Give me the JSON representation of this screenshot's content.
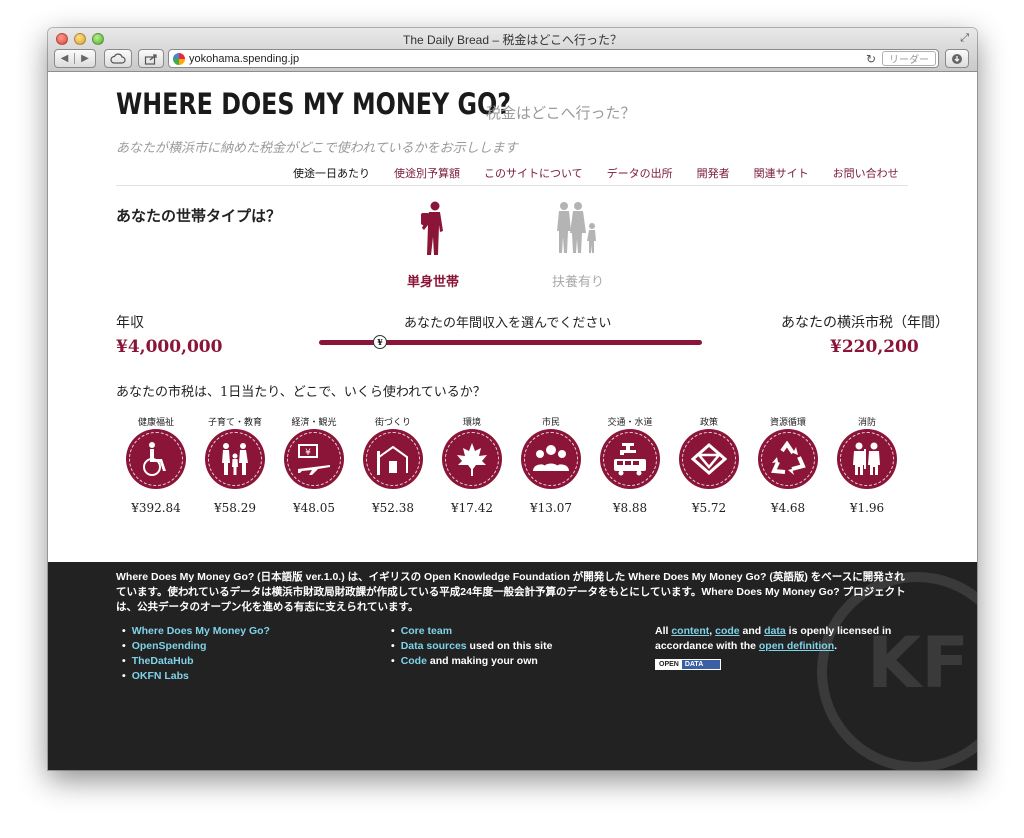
{
  "browser": {
    "title": "The Daily Bread – 税金はどこへ行った？",
    "url": "yokohama.spending.jp",
    "reader_label": "リーダー"
  },
  "header": {
    "title": "WHERE DOES MY MONEY GO?",
    "subtitle": "税金はどこへ行った？",
    "tagline": "あなたが横浜市に納めた税金がどこで使われているかをお示しします"
  },
  "nav": [
    {
      "label": "使途一日あたり",
      "active": true
    },
    {
      "label": "使途別予算額"
    },
    {
      "label": "このサイトについて"
    },
    {
      "label": "データの出所"
    },
    {
      "label": "開発者"
    },
    {
      "label": "関連サイト"
    },
    {
      "label": "お問い合わせ"
    }
  ],
  "household": {
    "question": "あなたの世帯タイプは？",
    "options": [
      {
        "label": "単身世帯",
        "selected": true
      },
      {
        "label": "扶養有り",
        "selected": false
      }
    ]
  },
  "income": {
    "label": "年収",
    "value": "¥4,000,000",
    "slider_label": "あなたの年間収入を選んでください",
    "knob_glyph": "¥"
  },
  "tax": {
    "label": "あなたの横浜市税（年間）",
    "value": "¥220,200"
  },
  "usage": {
    "question": "あなたの市税は、1日当たり、どこで、いくら使われているか？",
    "categories": [
      {
        "label": "健康福祉",
        "amount": "¥392.84",
        "icon": "wheelchair-icon"
      },
      {
        "label": "子育て・教育",
        "amount": "¥58.29",
        "icon": "family-icon"
      },
      {
        "label": "経済・観光",
        "amount": "¥48.05",
        "icon": "plane-money-icon"
      },
      {
        "label": "街づくり",
        "amount": "¥52.38",
        "icon": "house-icon"
      },
      {
        "label": "環境",
        "amount": "¥17.42",
        "icon": "leaf-icon"
      },
      {
        "label": "市民",
        "amount": "¥13.07",
        "icon": "people-icon"
      },
      {
        "label": "交通・水道",
        "amount": "¥8.88",
        "icon": "bus-tap-icon"
      },
      {
        "label": "政策",
        "amount": "¥5.72",
        "icon": "city-emblem-icon"
      },
      {
        "label": "資源循環",
        "amount": "¥4.68",
        "icon": "recycle-icon"
      },
      {
        "label": "消防",
        "amount": "¥1.96",
        "icon": "firefighter-icon"
      }
    ]
  },
  "footer": {
    "text": "Where Does My Money Go? (日本語版 ver.1.0.) は、イギリスの Open Knowledge Foundation が開発した Where Does My Money Go? (英語版) をベースに開発されています。使われているデータは横浜市財政局財政課が作成している平成24年度一般会計予算のデータをもとにしています。Where Does My Money Go? プロジェクトは、公共データのオープン化を進める有志に支えられています。",
    "links1": [
      "Where Does My Money Go?",
      "OpenSpending",
      "TheDataHub",
      "OKFN Labs"
    ],
    "links2": [
      {
        "link": "Core team",
        "rest": ""
      },
      {
        "link": "Data sources",
        "rest": " used on this site"
      },
      {
        "link": "Code",
        "rest": " and making your own"
      }
    ],
    "license": {
      "p1": "All ",
      "content": "content",
      "p2": ", ",
      "code": "code",
      "p3": " and ",
      "data": "data",
      "p4": " is openly licensed in accordance with the ",
      "definition": "open definition",
      "p5": "."
    },
    "badge_left": "OPEN",
    "badge_right": "DATA",
    "watermark": "KF"
  },
  "colors": {
    "accent": "#8a1538",
    "link": "#7fd3e8",
    "footer_bg": "#222222"
  }
}
